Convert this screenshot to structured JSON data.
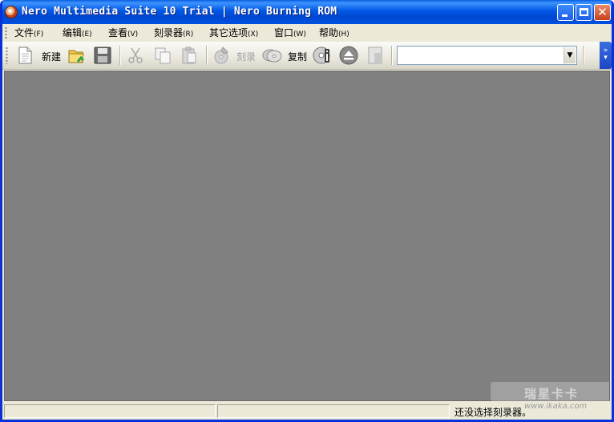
{
  "window": {
    "title": "Nero Multimedia Suite 10 Trial | Nero Burning ROM",
    "controls": {
      "minimize": "minimize",
      "maximize": "maximize",
      "close": "✕"
    }
  },
  "menu": {
    "items": [
      {
        "label": "文件",
        "accel": "(F)"
      },
      {
        "label": "编辑",
        "accel": "(E)"
      },
      {
        "label": "查看",
        "accel": "(V)"
      },
      {
        "label": "刻录器",
        "accel": "(R)"
      },
      {
        "label": "其它选项",
        "accel": "(X)"
      },
      {
        "label": "窗口",
        "accel": "(W)"
      },
      {
        "label": "帮助",
        "accel": "(H)"
      }
    ]
  },
  "toolbar": {
    "new_label": "新建",
    "burn_label": "刻录",
    "copy_label": "复制",
    "drive_select_value": "",
    "icons": [
      "new-doc-icon",
      "open-folder-icon",
      "save-icon",
      "cut-icon",
      "copy-icon",
      "paste-icon",
      "burn-icon",
      "disc-copy-icon",
      "disc-info-icon",
      "eject-icon",
      "doc-gray-icon"
    ]
  },
  "status": {
    "text": "还没选择刻录器。"
  },
  "watermark": {
    "main": "瑞星卡卡",
    "url": "www.ikaka.com"
  }
}
